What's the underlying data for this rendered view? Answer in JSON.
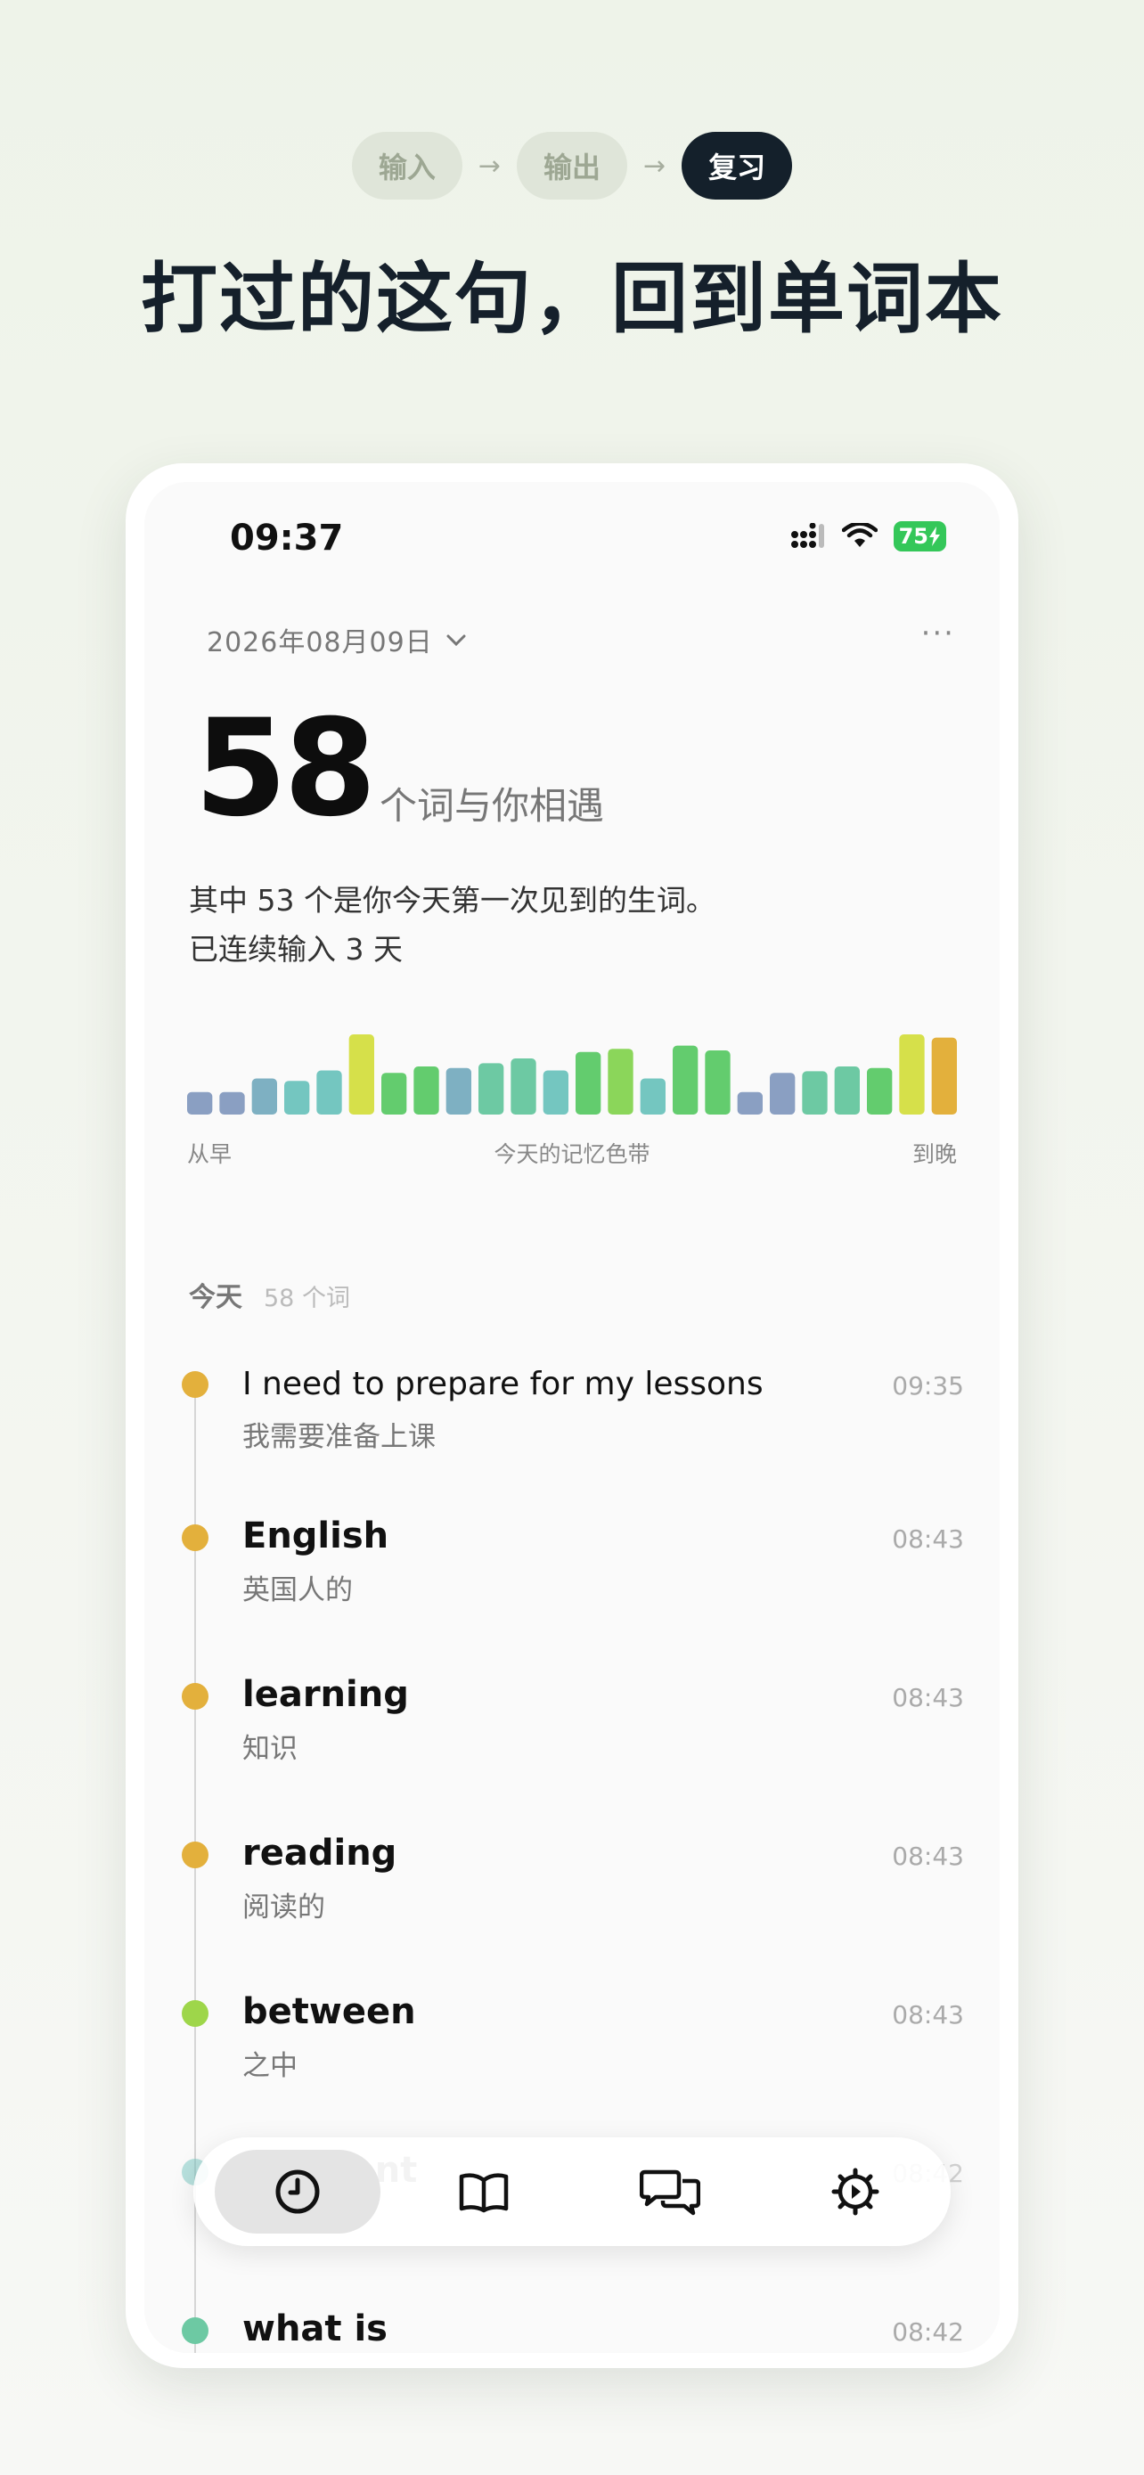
{
  "header": {
    "steps": [
      "输入",
      "输出",
      "复习"
    ],
    "arrow": "→",
    "headline": "打过的这句，回到单词本"
  },
  "status_bar": {
    "time": "09:37",
    "battery": "75"
  },
  "date_selector": {
    "label": "2026年08月09日",
    "chevron_icon": "chevron-down-icon",
    "more_icon": "more-dots-icon",
    "more_label": "···"
  },
  "summary": {
    "count": "58",
    "count_label": "个词与你相遇",
    "line1": "其中 53 个是你今天第一次见到的生词。",
    "line2": "已连续输入 3 天"
  },
  "color_band": {
    "label_left": "从早",
    "label_center": "今天的记忆色带",
    "label_right": "到晚",
    "bars": [
      {
        "h": 0.28,
        "color": "#8a9fc2"
      },
      {
        "h": 0.28,
        "color": "#8a9fc2"
      },
      {
        "h": 0.45,
        "color": "#7eb0c2"
      },
      {
        "h": 0.42,
        "color": "#74c6c0"
      },
      {
        "h": 0.55,
        "color": "#74c6c0"
      },
      {
        "h": 1.0,
        "color": "#d6e04a"
      },
      {
        "h": 0.52,
        "color": "#63cc6e"
      },
      {
        "h": 0.6,
        "color": "#63cc6e"
      },
      {
        "h": 0.58,
        "color": "#7eb0c2"
      },
      {
        "h": 0.64,
        "color": "#6dc9a3"
      },
      {
        "h": 0.7,
        "color": "#6dc9a3"
      },
      {
        "h": 0.55,
        "color": "#74c6c0"
      },
      {
        "h": 0.78,
        "color": "#63cc6e"
      },
      {
        "h": 0.82,
        "color": "#8bd65a"
      },
      {
        "h": 0.45,
        "color": "#74c6c0"
      },
      {
        "h": 0.86,
        "color": "#63cc6e"
      },
      {
        "h": 0.8,
        "color": "#63cc6e"
      },
      {
        "h": 0.28,
        "color": "#8a9fc2"
      },
      {
        "h": 0.52,
        "color": "#8a9fc2"
      },
      {
        "h": 0.54,
        "color": "#6dc9a3"
      },
      {
        "h": 0.6,
        "color": "#6dc9a3"
      },
      {
        "h": 0.58,
        "color": "#63cc6e"
      },
      {
        "h": 1.0,
        "color": "#d6e04a"
      },
      {
        "h": 0.96,
        "color": "#e3b03c"
      }
    ]
  },
  "today": {
    "title": "今天",
    "count_label": "58 个词",
    "entries": [
      {
        "word": "I need to prepare for my lessons",
        "meaning": "我需要准备上课",
        "time": "09:35",
        "color": "#e3b03c",
        "sentence": true
      },
      {
        "word": "English",
        "meaning": "英国人的",
        "time": "08:43",
        "color": "#e3b03c",
        "sentence": false
      },
      {
        "word": "learning",
        "meaning": "知识",
        "time": "08:43",
        "color": "#e3b03c",
        "sentence": false
      },
      {
        "word": "reading",
        "meaning": "阅读的",
        "time": "08:43",
        "color": "#e3b03c",
        "sentence": false
      },
      {
        "word": "between",
        "meaning": "之中",
        "time": "08:43",
        "color": "#9ed64a",
        "sentence": false
      },
      {
        "word": "different",
        "meaning": "",
        "time": "08:42",
        "color": "#74c6c0",
        "sentence": false
      },
      {
        "word": "what is",
        "meaning": "",
        "time": "08:42",
        "color": "#6dc9a3",
        "sentence": false
      }
    ]
  },
  "tab_bar": {
    "tabs": [
      {
        "icon": "clock-icon",
        "selected": true
      },
      {
        "icon": "book-icon",
        "selected": false
      },
      {
        "icon": "chat-bubbles-icon",
        "selected": false
      },
      {
        "icon": "gear-icon",
        "selected": false
      }
    ]
  },
  "colors": {
    "accent_dark": "#14202b",
    "battery_green": "#34c759"
  }
}
